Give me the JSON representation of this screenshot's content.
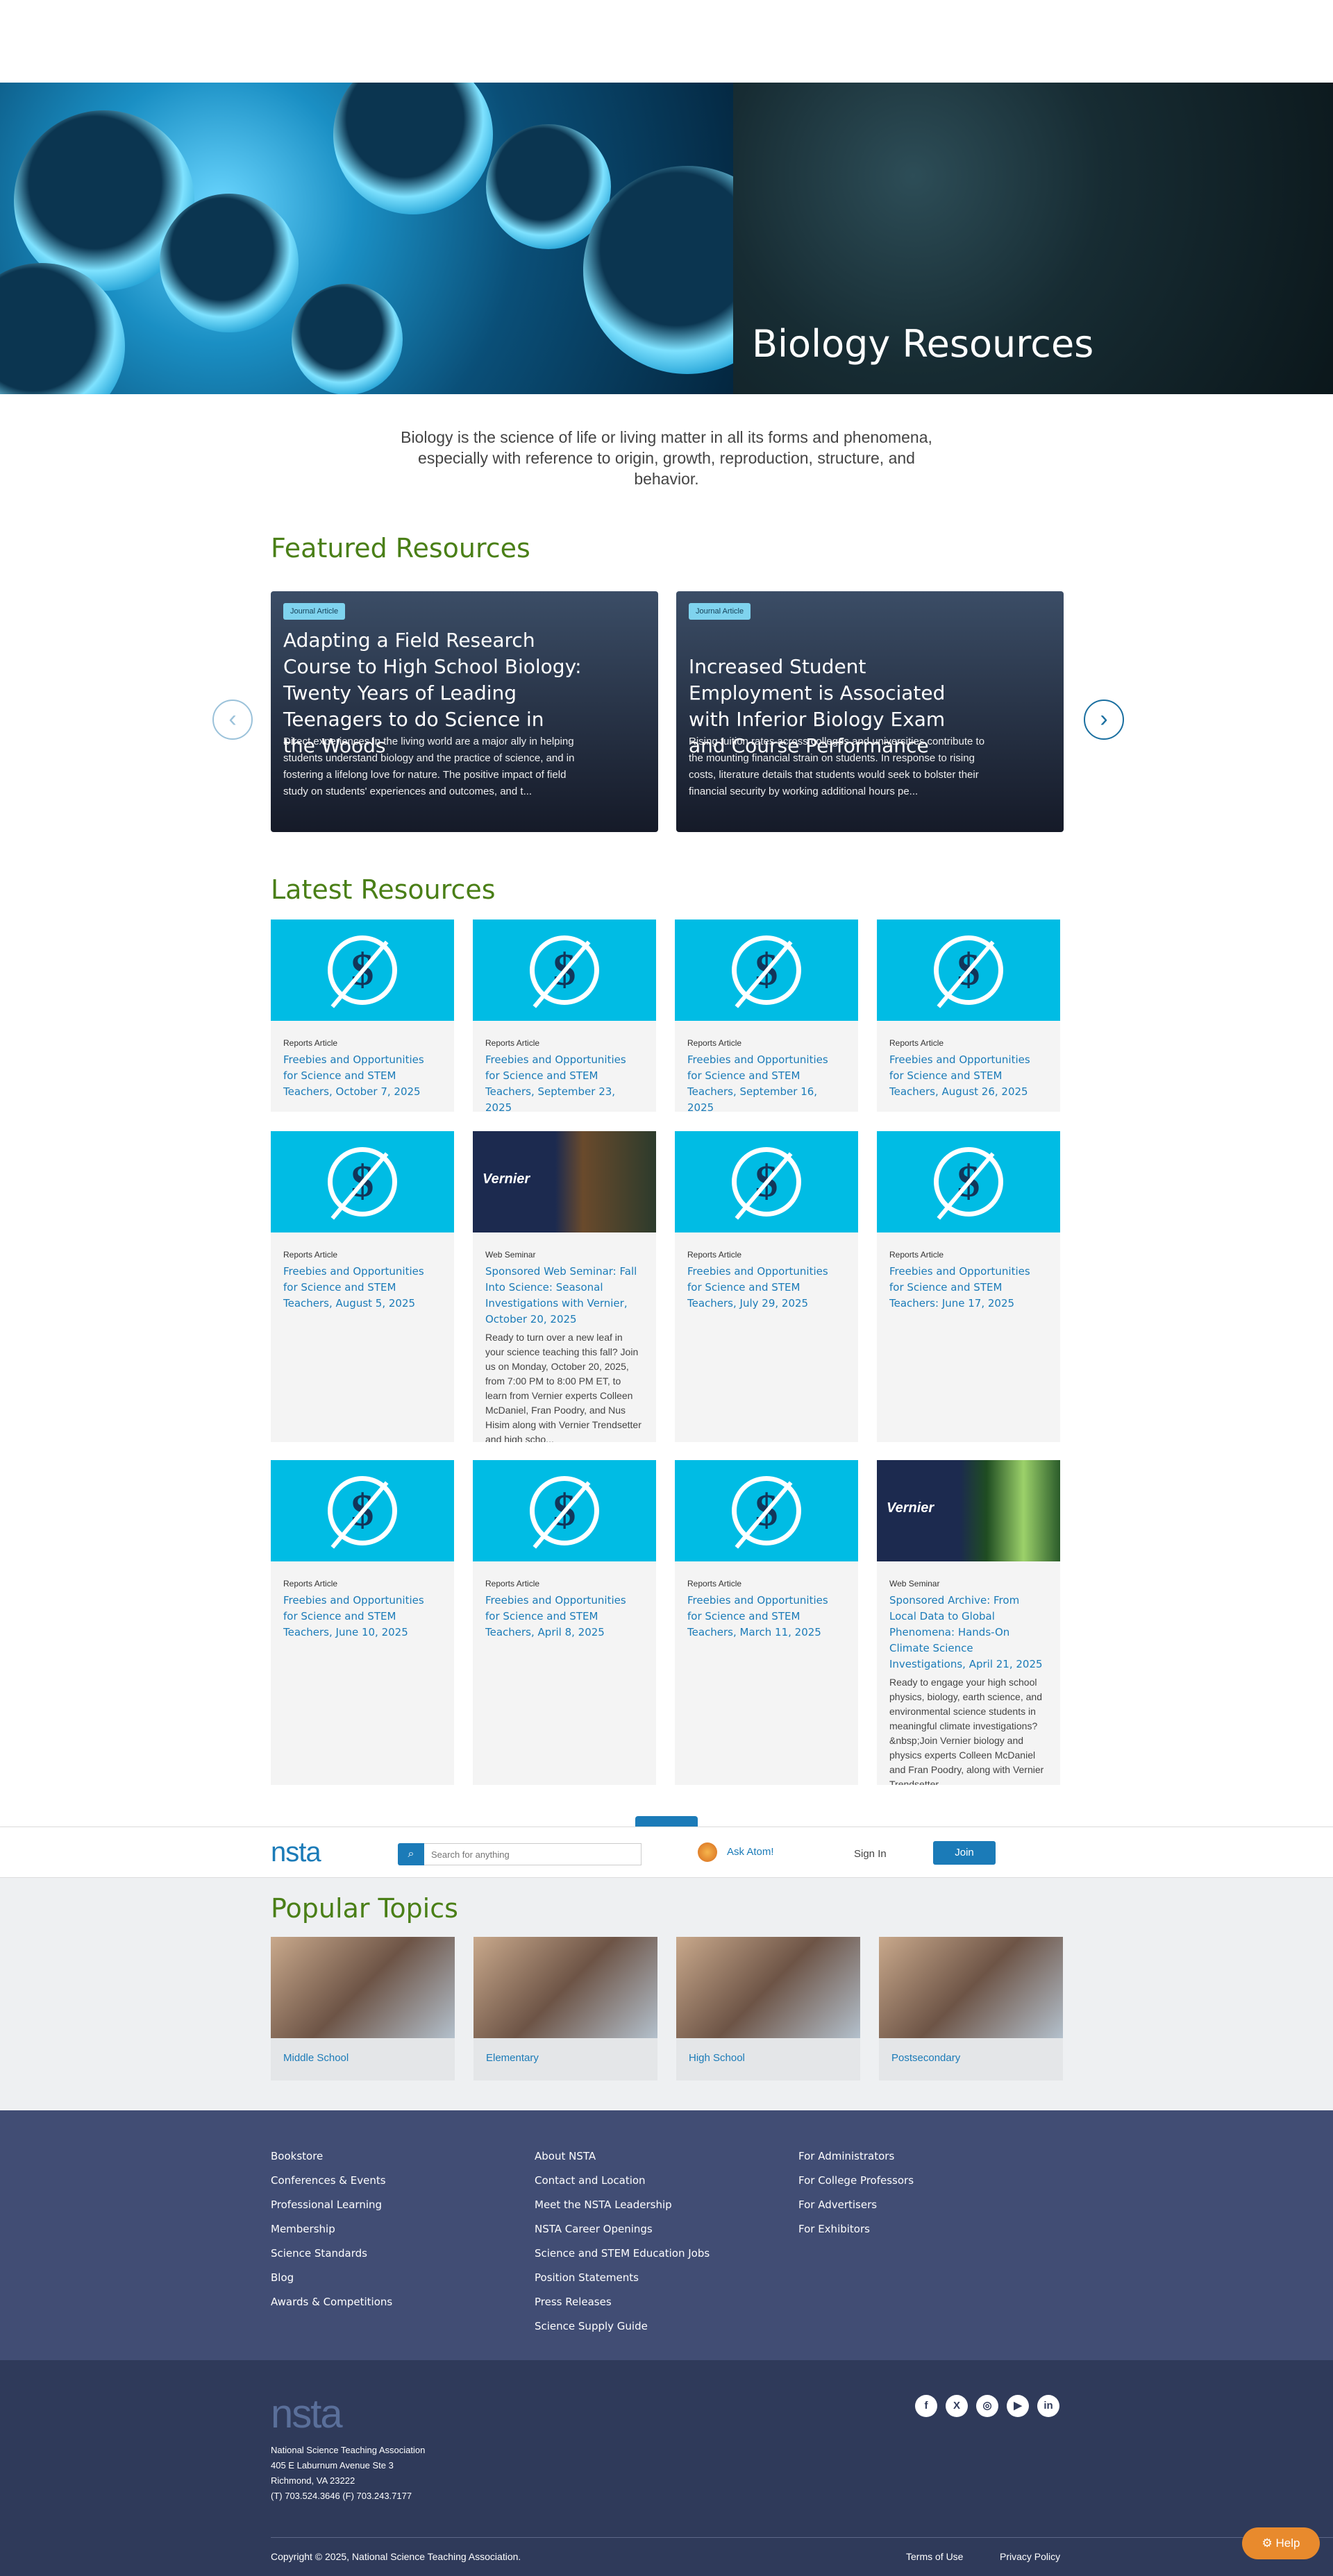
{
  "hero": {
    "title": "Biology Resources"
  },
  "intro": "Biology is the science of life or living matter in all its forms and phenomena, especially with reference to origin, growth, reproduction, structure, and behavior.",
  "featured": {
    "title": "Featured Resources",
    "items": [
      {
        "badge": "Journal Article",
        "title": "Adapting a Field Research Course to High School Biology: Twenty Years of Leading Teenagers to do Science in the Woods",
        "desc": "Direct experiences in the living world are a major ally in helping students understand biology and the practice of science, and in fostering a lifelong love for nature. The positive impact of field study on students' experiences and outcomes, and t..."
      },
      {
        "badge": "Journal Article",
        "title": "Increased Student Employment is Associated with Inferior Biology Exam and Course Performance",
        "desc": "Rising tuition rates across colleges and universities contribute to the mounting financial strain on students. In response to rising costs, literature details that students would seek to bolster their financial security by working additional hours pe..."
      }
    ]
  },
  "latest": {
    "title": "Latest Resources",
    "items": [
      {
        "type": "Reports Article",
        "title": "Freebies and Opportunities for Science and STEM Teachers, October 7, 2025",
        "desc": ""
      },
      {
        "type": "Reports Article",
        "title": "Freebies and Opportunities for Science and STEM Teachers, September 23, 2025",
        "desc": ""
      },
      {
        "type": "Reports Article",
        "title": "Freebies and Opportunities for Science and STEM Teachers, September 16, 2025",
        "desc": ""
      },
      {
        "type": "Reports Article",
        "title": "Freebies and Opportunities for Science and STEM Teachers, August 26, 2025",
        "desc": ""
      },
      {
        "type": "Reports Article",
        "title": "Freebies and Opportunities for Science and STEM Teachers, August 5, 2025",
        "desc": ""
      },
      {
        "type": "Web Seminar",
        "title": "Sponsored Web Seminar: Fall Into Science: Seasonal Investigations with Vernier, October 20, 2025",
        "desc": "Ready to turn over a new leaf in your science teaching this fall? Join us on Monday, October 20, 2025, from 7:00 PM to 8:00 PM ET, to learn from Vernier experts Colleen McDaniel, Fran Poodry, and Nus Hisim along with Vernier Trendsetter and high scho..."
      },
      {
        "type": "Reports Article",
        "title": "Freebies and Opportunities for Science and STEM Teachers, July 29, 2025",
        "desc": ""
      },
      {
        "type": "Reports Article",
        "title": "Freebies and Opportunities for Science and STEM Teachers: June 17, 2025",
        "desc": ""
      },
      {
        "type": "Reports Article",
        "title": "Freebies and Opportunities for Science and STEM Teachers, June 10, 2025",
        "desc": ""
      },
      {
        "type": "Reports Article",
        "title": "Freebies and Opportunities for Science and STEM Teachers, April 8, 2025",
        "desc": ""
      },
      {
        "type": "Reports Article",
        "title": "Freebies and Opportunities for Science and STEM Teachers, March 11, 2025",
        "desc": ""
      },
      {
        "type": "Web Seminar",
        "title": "Sponsored Archive: From Local Data to Global Phenomena: Hands-On Climate Science Investigations, April 21, 2025",
        "desc": "Ready to engage your high school physics, biology, earth science, and environmental science students in meaningful climate investigations? &nbsp;Join Vernier biology and physics experts Colleen McDaniel and Fran Poodry, along with Vernier Trendsetter..."
      }
    ],
    "vernier_logo": "Vernier"
  },
  "header": {
    "logo": "nsta",
    "search_placeholder": "Search for anything",
    "ask": "Ask Atom!",
    "signin": "Sign In",
    "join": "Join"
  },
  "topics": {
    "title": "Popular Topics",
    "items": [
      "Middle School",
      "Elementary",
      "High School",
      "Postsecondary"
    ]
  },
  "footer": {
    "col1": [
      "Bookstore",
      "Conferences & Events",
      "Professional Learning",
      "Membership",
      "Science Standards",
      "Blog",
      "Awards & Competitions"
    ],
    "col2": [
      "About NSTA",
      "Contact and Location",
      "Meet the NSTA Leadership",
      "NSTA Career Openings",
      "Science and STEM Education Jobs",
      "Position Statements",
      "Press Releases",
      "Science Supply Guide"
    ],
    "col3": [
      "For Administrators",
      "For College Professors",
      "For Advertisers",
      "For Exhibitors"
    ],
    "logo": "nsta",
    "address": [
      "National Science Teaching Association",
      "405 E Laburnum Avenue Ste 3",
      "Richmond, VA 23222",
      "(T) 703.524.3646 (F) 703.243.7177"
    ],
    "copyright": "Copyright © 2025, National Science Teaching Association.",
    "terms": "Terms of Use",
    "privacy": "Privacy Policy",
    "social": [
      "f",
      "X",
      "◎",
      "▶",
      "in"
    ]
  },
  "help": "Help"
}
